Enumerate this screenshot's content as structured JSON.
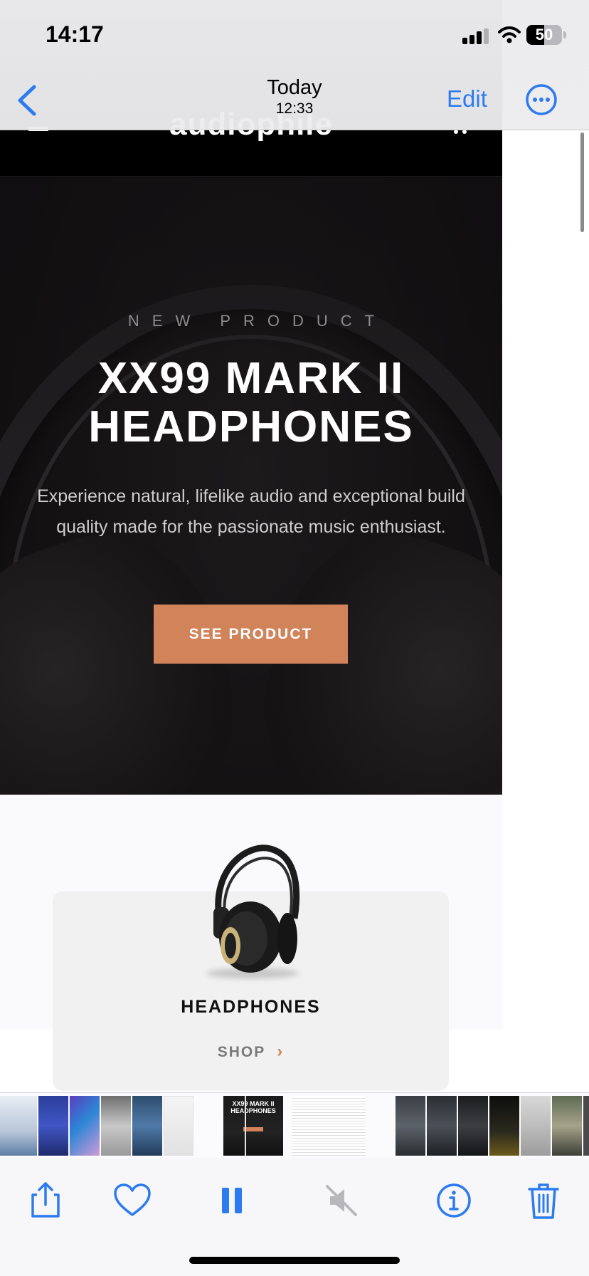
{
  "status_bar": {
    "time": "14:17",
    "battery": "50"
  },
  "nav_bar": {
    "title": "Today",
    "subtitle": "12:33",
    "edit_label": "Edit"
  },
  "website": {
    "logo": "audiophile",
    "hero": {
      "overline": "NEW PRODUCT",
      "title": "XX99 MARK II HEADPHONES",
      "description": "Experience natural, lifelike audio and exceptional build quality made for the passionate music enthusiast.",
      "button_label": "SEE PRODUCT",
      "accent_color": "#d1835a"
    },
    "category": {
      "label": "HEADPHONES",
      "shop_label": "SHOP",
      "chevron": "›"
    }
  },
  "thumbnail_strip": {
    "selected_thumb_title": "XX99 MARK II HEADPHONES"
  },
  "toolbar": {
    "icons": [
      "share-icon",
      "heart-icon",
      "pause-icon",
      "mute-icon",
      "info-icon",
      "trash-icon"
    ]
  },
  "colors": {
    "ios_blue": "#2d7bf0",
    "hero_background": "#141213"
  }
}
